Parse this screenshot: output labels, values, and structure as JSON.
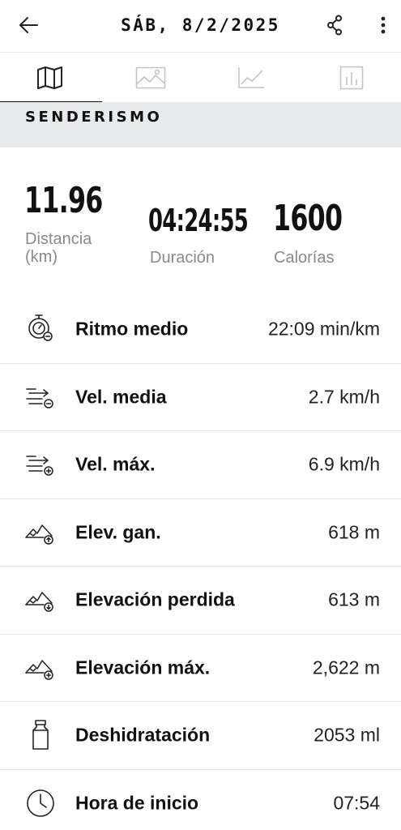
{
  "header": {
    "title": "SÁB, 8/2/2025",
    "back_icon": "arrow-left-icon",
    "share_icon": "share-icon",
    "more_icon": "more-vertical-icon"
  },
  "tabs": [
    {
      "icon": "map-icon",
      "selected": true
    },
    {
      "icon": "image-icon",
      "selected": false
    },
    {
      "icon": "line-chart-icon",
      "selected": false
    },
    {
      "icon": "bar-chart-icon",
      "selected": false
    }
  ],
  "sport": {
    "label": "SENDERISMO"
  },
  "summary": {
    "distance": {
      "value": "11.96",
      "label": "Distancia (km)"
    },
    "duration": {
      "value": "04:24:55",
      "label": "Duración"
    },
    "calories": {
      "value": "1600",
      "label": "Calorías"
    }
  },
  "metrics": [
    {
      "icon": "stopwatch-pace-icon",
      "label": "Ritmo medio",
      "value": "22:09 min/km"
    },
    {
      "icon": "speed-average-icon",
      "label": "Vel. media",
      "value": "2.7 km/h"
    },
    {
      "icon": "speed-max-icon",
      "label": "Vel. máx.",
      "value": "6.9 km/h"
    },
    {
      "icon": "elevation-gain-icon",
      "label": "Elev. gan.",
      "value": "618 m"
    },
    {
      "icon": "elevation-loss-icon",
      "label": "Elevación perdida",
      "value": "613 m"
    },
    {
      "icon": "elevation-max-icon",
      "label": "Elevación máx.",
      "value": "2,622 m"
    },
    {
      "icon": "bottle-icon",
      "label": "Deshidratación",
      "value": "2053 ml"
    },
    {
      "icon": "clock-icon",
      "label": "Hora de inicio",
      "value": "07:54"
    }
  ]
}
